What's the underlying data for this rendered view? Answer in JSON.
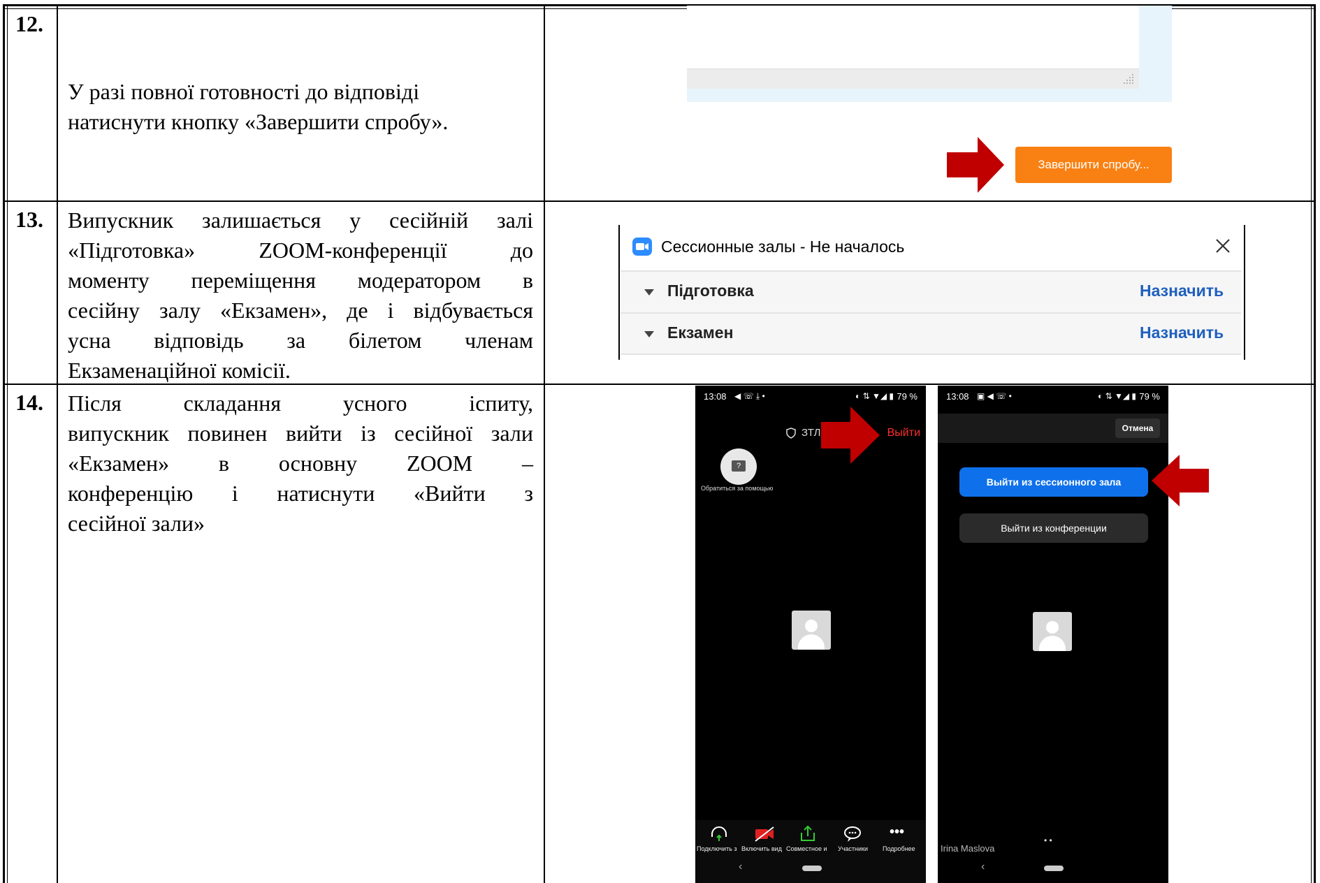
{
  "rows": [
    {
      "num": "12.",
      "text": [
        "У разі повної готовності до відповіді",
        "натиснути кнопку «Завершити спробу»."
      ]
    },
    {
      "num": "13.",
      "text": [
        "Випускник залишається у сесійній залі",
        "«Підготовка» ZOOM-конференції до",
        "моменту переміщення модератором в",
        "сесійну залу «Екзамен», де і відбувається",
        "усна відповідь за білетом членам",
        "Екзаменаційної комісії."
      ]
    },
    {
      "num": "14.",
      "text": [
        "Після складання усного іспиту,",
        "випускник повинен вийти із сесійної зали",
        "«Екзамен» в основну ZOOM –",
        "конференцію і натиснути «Вийти з",
        "сесійної зали»"
      ]
    }
  ],
  "row12_screenshot": {
    "finish_button": "Завершити спробу..."
  },
  "row13_screenshot": {
    "title": "Сессионные залы - Не началось",
    "rooms": [
      {
        "name": "Підготовка",
        "action": "Назначить"
      },
      {
        "name": "Екзамен",
        "action": "Назначить"
      }
    ]
  },
  "phone_left": {
    "status_time": "13:08",
    "status_right": "79 %",
    "meeting_label": "ЗТЛ",
    "leave_label": "Выйти",
    "help_label": "Обратиться за помощью",
    "toolbar": [
      "Подключить з",
      "Включить вид",
      "Совместное и",
      "Участники",
      "Подробнее"
    ]
  },
  "phone_right": {
    "status_time": "13:08",
    "status_right": "79 %",
    "cancel_label": "Отмена",
    "leave_room_button": "Выйти из сессионного зала",
    "leave_meeting_button": "Выйти из конференции",
    "participant_name": "Irina Maslova"
  },
  "colors": {
    "arrow": "#c00000",
    "moodle_orange": "#f98012",
    "zoom_blue": "#0e71eb",
    "zoom_link": "#1e5fbf"
  }
}
